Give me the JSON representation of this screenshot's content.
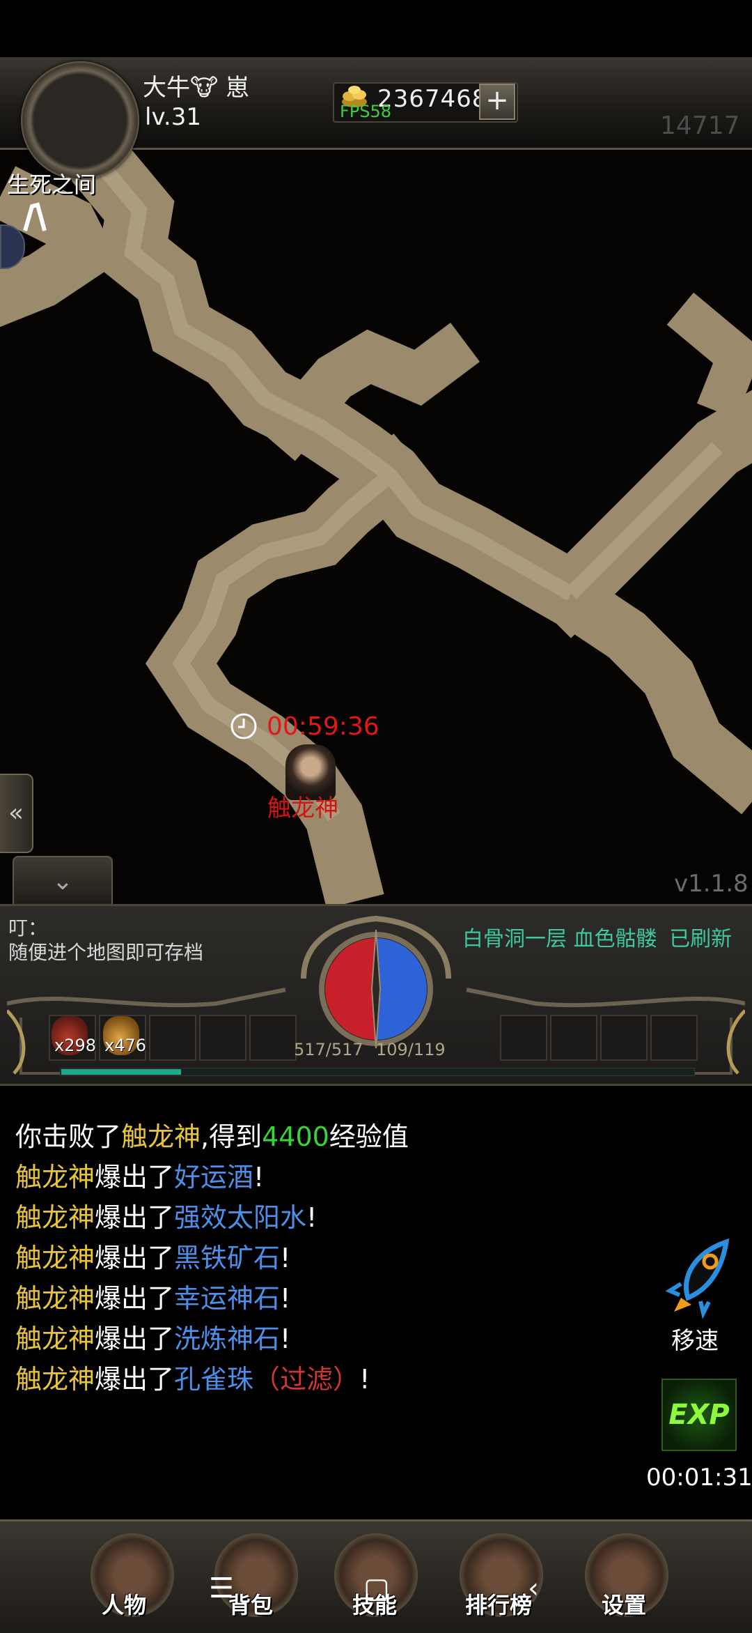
{
  "player": {
    "name": "大牛🐮 崽",
    "level": "lv.31"
  },
  "currency": {
    "gold": "2367468",
    "fps": "FPS58",
    "plus": "+"
  },
  "score": "14717",
  "map": {
    "name": "生死之间",
    "boss_timer": "00:59:36",
    "boss_name": "触龙神",
    "version": "v1.1.8",
    "side_arrow": "«",
    "down_arrow": "⌄"
  },
  "notice": {
    "title": "叮：",
    "body": "随便进个地图即可存档"
  },
  "refresh": {
    "place": "白骨洞一层",
    "monster": "血色骷髅",
    "status": "已刷新"
  },
  "potions": {
    "hp_count": "x298",
    "mp_count": "x476"
  },
  "stats": {
    "hp": "517/517",
    "mp": "109/119",
    "exp_fraction": 0.19
  },
  "chat": [
    {
      "segments": [
        {
          "t": "你击败了",
          "c": "w"
        },
        {
          "t": "触龙神",
          "c": "y"
        },
        {
          "t": ",得到",
          "c": "w"
        },
        {
          "t": "4400",
          "c": "g"
        },
        {
          "t": "经验值",
          "c": "w"
        }
      ]
    },
    {
      "segments": [
        {
          "t": "触龙神",
          "c": "y"
        },
        {
          "t": "爆出了",
          "c": "w"
        },
        {
          "t": "好运酒",
          "c": "b"
        },
        {
          "t": "!",
          "c": "w"
        }
      ]
    },
    {
      "segments": [
        {
          "t": "触龙神",
          "c": "y"
        },
        {
          "t": "爆出了",
          "c": "w"
        },
        {
          "t": "强效太阳水",
          "c": "b"
        },
        {
          "t": "!",
          "c": "w"
        }
      ]
    },
    {
      "segments": [
        {
          "t": "触龙神",
          "c": "y"
        },
        {
          "t": "爆出了",
          "c": "w"
        },
        {
          "t": "黑铁矿石",
          "c": "b"
        },
        {
          "t": "!",
          "c": "w"
        }
      ]
    },
    {
      "segments": [
        {
          "t": "触龙神",
          "c": "y"
        },
        {
          "t": "爆出了",
          "c": "w"
        },
        {
          "t": "幸运神石",
          "c": "b"
        },
        {
          "t": "!",
          "c": "w"
        }
      ]
    },
    {
      "segments": [
        {
          "t": "触龙神",
          "c": "y"
        },
        {
          "t": "爆出了",
          "c": "w"
        },
        {
          "t": "洗炼神石",
          "c": "b"
        },
        {
          "t": "!",
          "c": "w"
        }
      ]
    },
    {
      "segments": [
        {
          "t": "触龙神",
          "c": "y"
        },
        {
          "t": "爆出了",
          "c": "w"
        },
        {
          "t": "孔雀珠",
          "c": "b"
        },
        {
          "t": "（过滤）",
          "c": "r"
        },
        {
          "t": "!",
          "c": "w"
        }
      ]
    }
  ],
  "speed": {
    "label": "移速"
  },
  "exp_boost": {
    "label": "EXP",
    "timer": "00:01:31"
  },
  "nav": {
    "character": "人物",
    "bag": "背包",
    "skills": "技能",
    "ranking": "排行榜",
    "settings": "设置"
  },
  "system_nav": {
    "menu": "☰",
    "home": "▢",
    "back": "‹"
  },
  "colors": {
    "gold_text": "#e7c43a",
    "item_blue": "#4d8ee8",
    "exp_green": "#36d436",
    "boss_red": "#d31414",
    "refresh_green": "#3ec8a0"
  }
}
